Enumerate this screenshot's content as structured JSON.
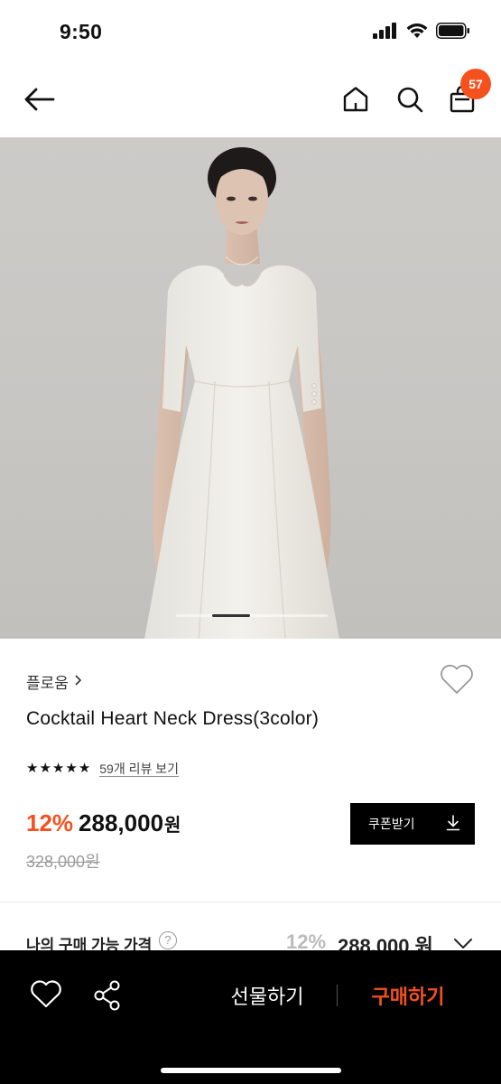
{
  "status_bar": {
    "time": "9:50",
    "icons": [
      "cellular-signal-icon",
      "wifi-icon",
      "battery-icon"
    ]
  },
  "nav": {
    "icons": [
      "back-arrow-icon",
      "home-icon",
      "search-icon",
      "cart-icon"
    ],
    "cart_count": "57"
  },
  "product": {
    "brand": "플로움",
    "title": "Cocktail Heart Neck Dress(3color)",
    "rating_stars": 5,
    "review_link": "59개 리뷰 보기",
    "discount": "12%",
    "price": "288,000",
    "currency": "원",
    "original_price": "328,000원",
    "image_pager": {
      "pages_visible": 1
    }
  },
  "coupon": {
    "label": "쿠폰받기",
    "icon": "download-icon"
  },
  "my_price": {
    "label": "나의 구매 가능 가격",
    "help_glyph": "?",
    "discount": "12%",
    "price": "288,000 원"
  },
  "bottom_bar": {
    "gift_label": "선물하기",
    "buy_label": "구매하기",
    "icons": [
      "heart-outline-icon",
      "share-icon"
    ]
  },
  "colors": {
    "accent": "#f4511e",
    "bottom_bar_bg": "#000000",
    "coupon_bg": "#000000"
  }
}
